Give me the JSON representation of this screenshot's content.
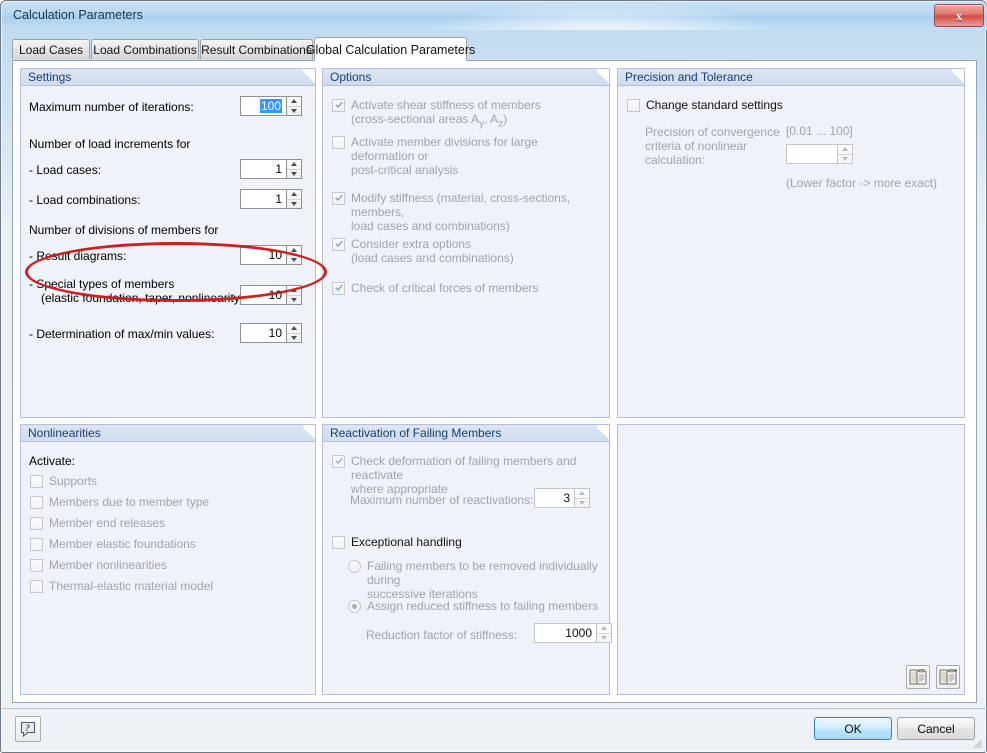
{
  "window": {
    "title": "Calculation Parameters",
    "close_label": "x"
  },
  "tabs": [
    {
      "label": "Load Cases",
      "active": false
    },
    {
      "label": "Load Combinations",
      "active": false
    },
    {
      "label": "Result Combinations",
      "active": false
    },
    {
      "label": "Global Calculation Parameters",
      "active": true
    }
  ],
  "settings": {
    "title": "Settings",
    "max_iterations_label": "Maximum number of iterations:",
    "max_iterations_value": "100",
    "load_increments_header": "Number of load increments for",
    "load_cases_label": "- Load cases:",
    "load_cases_value": "1",
    "load_combinations_label": "- Load combinations:",
    "load_combinations_value": "1",
    "divisions_header": "Number of divisions of members for",
    "result_diagrams_label": "- Result diagrams:",
    "result_diagrams_value": "10",
    "special_types_label_line1": "- Special types of members",
    "special_types_label_line2": "(elastic foundation, taper, nonlinearity):",
    "special_types_value": "10",
    "maxmin_label": "- Determination of max/min values:",
    "maxmin_value": "10"
  },
  "options": {
    "title": "Options",
    "items": [
      {
        "label_line1": "Activate shear stiffness of members",
        "label_line2": "(cross-sectional areas Ay, Az)",
        "checked": true,
        "enabled": false
      },
      {
        "label_line1": "Activate member divisions for large deformation or",
        "label_line2": "post-critical analysis",
        "checked": false,
        "enabled": false
      },
      {
        "label_line1": "Modify stiffness (material, cross-sections, members,",
        "label_line2": "load cases and combinations)",
        "checked": true,
        "enabled": false
      },
      {
        "label_line1": "Consider extra options",
        "label_line2": "(load cases and combinations)",
        "checked": true,
        "enabled": false
      },
      {
        "label_line1": "Check of critical forces of members",
        "label_line2": "",
        "checked": true,
        "enabled": false
      }
    ]
  },
  "precision": {
    "title": "Precision and Tolerance",
    "change_standard_label": "Change standard settings",
    "change_standard_checked": false,
    "convergence_label_line1": "Precision of convergence",
    "convergence_label_line2": "criteria of nonlinear",
    "convergence_label_line3": "calculation:",
    "range_hint": "[0.01 ... 100]",
    "convergence_value": "",
    "footnote": "(Lower factor -> more exact)"
  },
  "nonlinearities": {
    "title": "Nonlinearities",
    "activate_label": "Activate:",
    "items": [
      {
        "label": "Supports",
        "checked": false
      },
      {
        "label": "Members due to member type",
        "checked": false
      },
      {
        "label": "Member end releases",
        "checked": false
      },
      {
        "label": "Member elastic foundations",
        "checked": false
      },
      {
        "label": "Member nonlinearities",
        "checked": false
      },
      {
        "label": "Thermal-elastic material model",
        "checked": false
      }
    ]
  },
  "reactivation": {
    "title": "Reactivation of Failing Members",
    "check_deformation_line1": "Check deformation of failing members and reactivate",
    "check_deformation_line2": "where appropriate",
    "check_deformation_checked": true,
    "max_reactivations_label": "Maximum number of reactivations:",
    "max_reactivations_value": "3",
    "exceptional_handling_label": "Exceptional handling",
    "exceptional_handling_checked": false,
    "radio_remove_line1": "Failing members to be removed individually during",
    "radio_remove_line2": "successive iterations",
    "radio_remove_selected": false,
    "radio_reduced_label": "Assign reduced stiffness to failing members",
    "radio_reduced_selected": true,
    "reduction_factor_label": "Reduction factor of stiffness:",
    "reduction_factor_value": "1000"
  },
  "footer": {
    "help_label": "?",
    "ok_label": "OK",
    "cancel_label": "Cancel"
  },
  "colors": {
    "accent_blue": "#3399ff",
    "panel_bg": "#eff2f8",
    "panel_border": "#b6bedd",
    "group_title_text": "#1c3c70",
    "annotation_red": "#cc2020",
    "disabled_text": "#a0a4a8"
  }
}
